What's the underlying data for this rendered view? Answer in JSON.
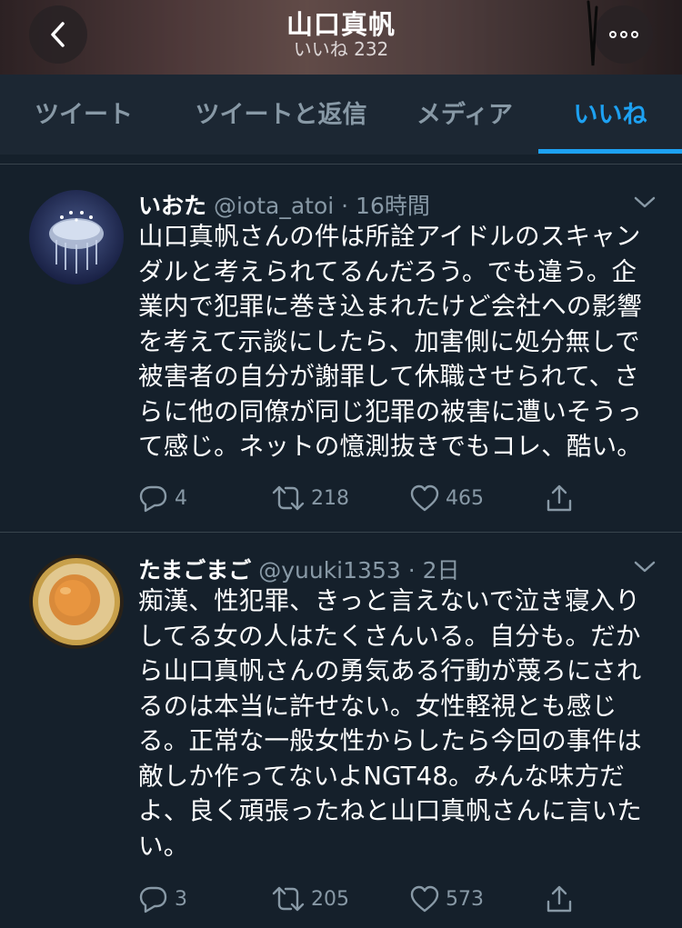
{
  "header": {
    "title": "山口真帆",
    "subtitle": "いいね 232"
  },
  "tabs": [
    {
      "label": "ツイート",
      "active": false
    },
    {
      "label": "ツイートと返信",
      "active": false
    },
    {
      "label": "メディア",
      "active": false
    },
    {
      "label": "いいね",
      "active": true
    }
  ],
  "tweets": [
    {
      "name": "いおた",
      "meta": "@iota_atoi · 16時間",
      "text": "山口真帆さんの件は所詮アイドルのスキャンダルと考えられてるんだろう。でも違う。企業内で犯罪に巻き込まれたけど会社への影響を考えて示談にしたら、加害側に処分無しで被害者の自分が謝罪して休職させられて、さらに他の同僚が同じ犯罪の被害に遭いそうって感じ。ネットの憶測抜きでもコレ、酷い。",
      "replies": "4",
      "retweets": "218",
      "likes": "465"
    },
    {
      "name": "たまごまご",
      "meta": "@yuuki1353 · 2日",
      "text": "痴漢、性犯罪、きっと言えないで泣き寝入りしてる女の人はたくさんいる。自分も。だから山口真帆さんの勇気ある行動が蔑ろにされるのは本当に許せない。女性軽視とも感じる。正常な一般女性からしたら今回の事件は敵しか作ってないよNGT48。みんな味方だよ、良く頑張ったねと山口真帆さんに言いたい。",
      "replies": "3",
      "retweets": "205",
      "likes": "573"
    }
  ],
  "colors": {
    "background": "#15202b",
    "tab_bar": "#1c2733",
    "accent": "#1da1f2",
    "secondary_text": "#8899a6",
    "divider": "#38444d"
  },
  "icons": {
    "back": "chevron-left-icon",
    "more": "more-dots-icon",
    "caret": "chevron-down-icon",
    "reply": "reply-icon",
    "retweet": "retweet-icon",
    "like": "heart-icon",
    "share": "share-icon"
  }
}
